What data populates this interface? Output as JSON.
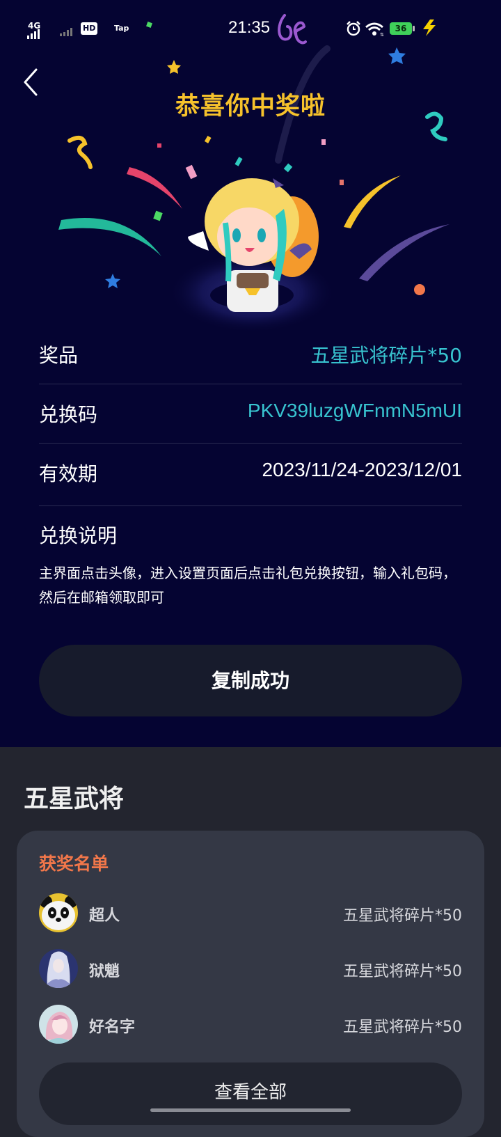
{
  "status_bar": {
    "signal_label": "4G",
    "hd_label": "HD",
    "tap_label": "Tap",
    "time": "21:35",
    "battery": "36"
  },
  "header": {
    "title": "恭喜你中奖啦"
  },
  "prize_info": {
    "prize_label": "奖品",
    "prize_value": "五星武将碎片*50",
    "code_label": "兑换码",
    "code_value": "PKV39luzgWFnmN5mUI",
    "validity_label": "有效期",
    "validity_value": "2023/11/24-2023/12/01",
    "instructions_title": "兑换说明",
    "instructions_text": "主界面点击头像，进入设置页面后点击礼包兑换按钮，输入礼包码，然后在邮箱领取即可"
  },
  "copy_button": "复制成功",
  "section": {
    "title": "五星武将",
    "list_title": "获奖名单",
    "winners": [
      {
        "name": "超人",
        "prize": "五星武将碎片*50",
        "avatar": "panda-avatar"
      },
      {
        "name": "狱魈",
        "prize": "五星武将碎片*50",
        "avatar": "character-avatar"
      },
      {
        "name": "好名字",
        "prize": "五星武将碎片*50",
        "avatar": "anime-girl-avatar"
      }
    ],
    "view_all": "查看全部"
  },
  "colors": {
    "background_top": "#050432",
    "background_bottom": "#23252f",
    "title_gold": "#f6c22b",
    "teal_value": "#38c4d0",
    "list_title_orange": "#f2774a"
  }
}
